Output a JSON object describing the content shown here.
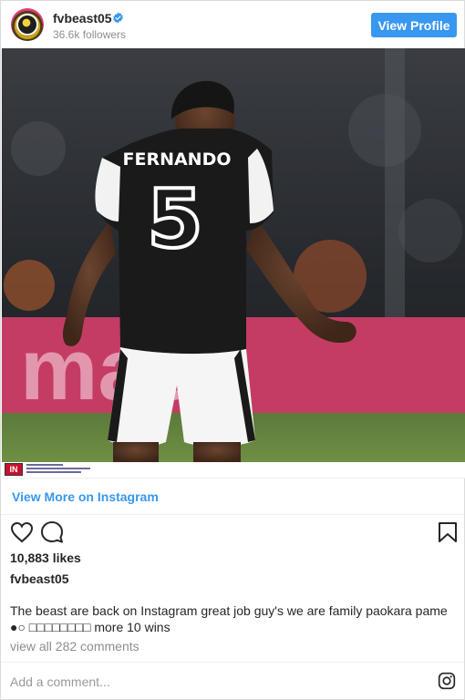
{
  "header": {
    "username": "fvbeast05",
    "followers": "36.6k followers",
    "view_profile_label": "View Profile",
    "verified_color": "#3897f0"
  },
  "photo": {
    "jersey_name": "FERNANDO",
    "jersey_number": "5",
    "banner_text": "mach"
  },
  "attribution": {
    "logo_text": "IN"
  },
  "view_more_label": "View More on Instagram",
  "actions": {
    "icons": [
      "heart-icon",
      "comment-icon",
      "bookmark-icon"
    ]
  },
  "likes": "10,883 likes",
  "caption": {
    "username": "fvbeast05",
    "text": "The beast are back on Instagram great job guy's we are family paokara pame ●○ □□□□□□□□ more 10 wins"
  },
  "comments_link": "view all 282 comments",
  "add_comment_placeholder": "Add a comment...",
  "colors": {
    "accent": "#3897f0",
    "text": "#262626",
    "muted": "#8e8e8e"
  }
}
